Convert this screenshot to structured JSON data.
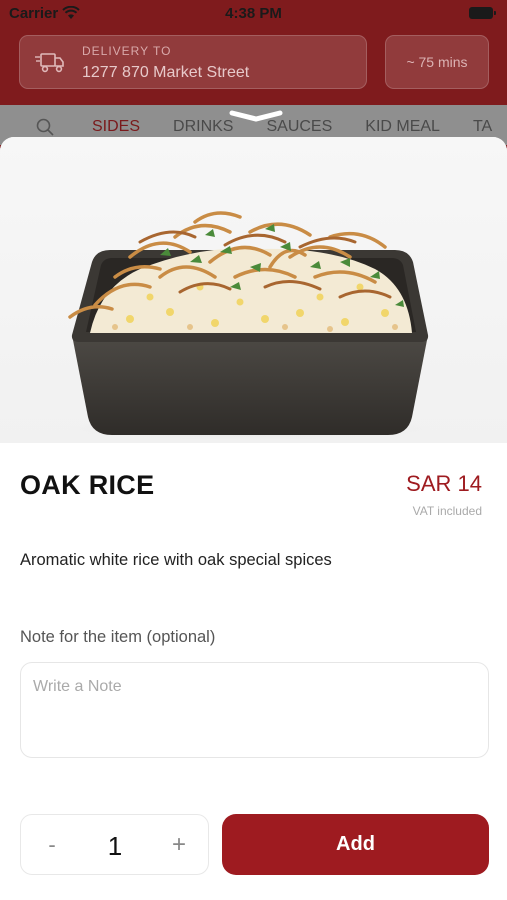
{
  "status_bar": {
    "carrier": "Carrier",
    "time": "4:38 PM"
  },
  "header": {
    "delivery_label": "DELIVERY TO",
    "delivery_address": "1277 870 Market Street",
    "eta": "~ 75 mins"
  },
  "categories": {
    "items": [
      "SIDES",
      "DRINKS",
      "SAUCES",
      "KID MEAL",
      "TA"
    ],
    "active": "SIDES"
  },
  "item": {
    "title": "OAK RICE",
    "price": "SAR 14",
    "vat_note": "VAT included",
    "description": "Aromatic white rice with oak special spices"
  },
  "note": {
    "label": "Note for the item (optional)",
    "placeholder": "Write a Note",
    "value": ""
  },
  "quantity": {
    "minus": "-",
    "value": "1",
    "plus": "+"
  },
  "add_button": {
    "label": "Add"
  },
  "colors": {
    "brand": "#9e1b20",
    "header": "#7f1b1d"
  }
}
